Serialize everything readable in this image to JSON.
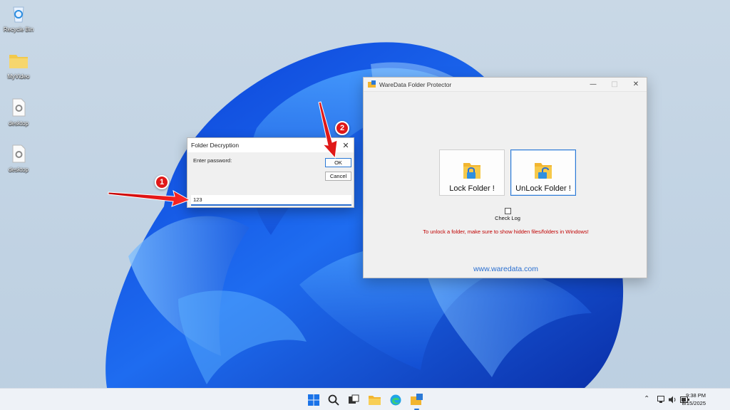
{
  "desktop": {
    "icons": [
      {
        "label": "Recycle Bin"
      },
      {
        "label": "MyVideo"
      },
      {
        "label": "desktop"
      },
      {
        "label": "desktop"
      }
    ]
  },
  "main_window": {
    "title": "WareData Folder Protector",
    "lock_button": "Lock Folder !",
    "unlock_button": "UnLock Folder !",
    "check_log": "Check Log",
    "warning": "To unlock a folder, make sure to show hidden files/folders in Windows!",
    "website": "www.waredata.com"
  },
  "dialog": {
    "title": "Folder Decryption",
    "prompt": "Enter password:",
    "ok": "OK",
    "cancel": "Cancel",
    "password_value": "123"
  },
  "annotations": {
    "step1": "1",
    "step2": "2"
  },
  "taskbar": {
    "time": "9:38 PM",
    "date": "8/15/2025"
  }
}
